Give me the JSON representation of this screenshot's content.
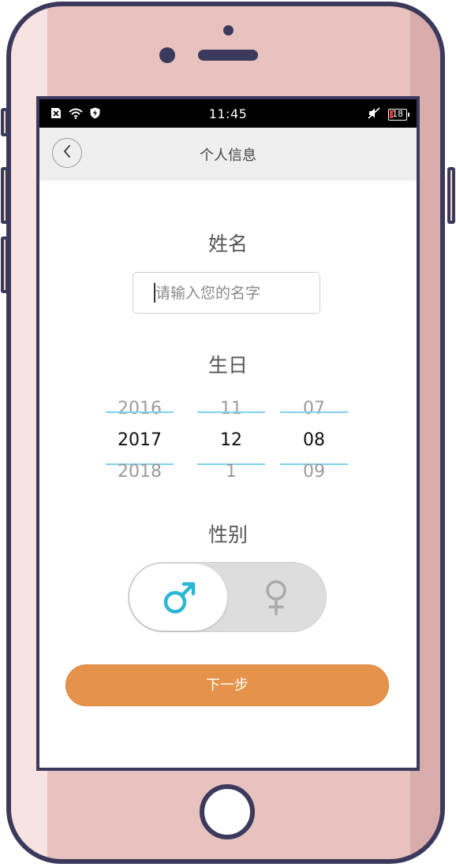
{
  "status_bar": {
    "time": "11:45",
    "battery_level": "18",
    "left_icons": [
      "no-sim-icon",
      "wifi-icon",
      "shield-icon"
    ],
    "right_icons": [
      "mute-icon",
      "battery-icon"
    ]
  },
  "nav": {
    "title": "个人信息",
    "back_icon": "chevron-left-icon"
  },
  "name_section": {
    "title": "姓名",
    "placeholder": "请输入您的名字",
    "value": ""
  },
  "birthday_section": {
    "title": "生日",
    "year": {
      "prev": "2016",
      "selected": "2017",
      "next": "2018"
    },
    "month": {
      "prev": "11",
      "selected": "12",
      "next": "1"
    },
    "day": {
      "prev": "07",
      "selected": "08",
      "next": "09"
    }
  },
  "gender_section": {
    "title": "性别",
    "selected": "male",
    "male_icon": "male-symbol-icon",
    "female_icon": "female-symbol-icon"
  },
  "next_button": {
    "label": "下一步"
  },
  "colors": {
    "accent_orange": "#e5924b",
    "picker_line": "#7ed3ef",
    "male_icon_color": "#2bb7d3",
    "phone_body": "#e8c2be",
    "phone_outline": "#3c3a5c"
  }
}
